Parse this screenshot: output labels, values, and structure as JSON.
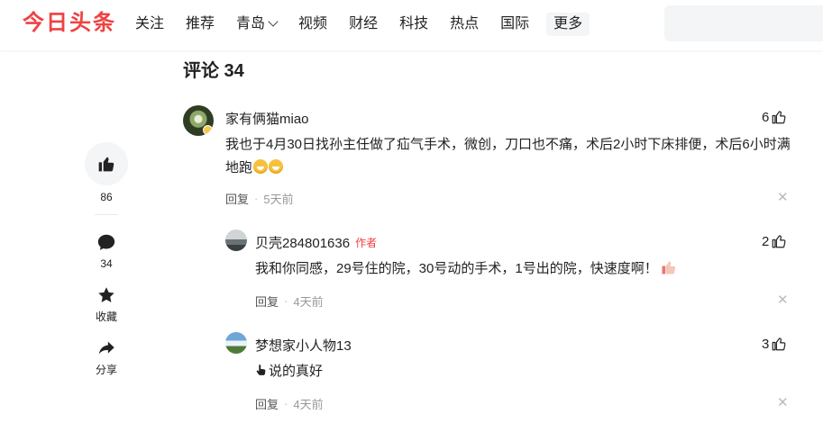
{
  "header": {
    "logo": "今日头条",
    "nav": [
      "关注",
      "推荐",
      "青岛",
      "视频",
      "财经",
      "科技",
      "热点",
      "国际"
    ],
    "more": "更多"
  },
  "side": {
    "like_count": "86",
    "comment_count": "34",
    "collect_label": "收藏",
    "share_label": "分享"
  },
  "comments_title": "评论 34",
  "comments": [
    {
      "name": "家有俩猫miao",
      "likes": "6",
      "content": "我也于4月30日找孙主任做了疝气手术，微创，刀口也不痛，术后2小时下床排便，术后6小时满地跑",
      "reply": "回复",
      "time": "5天前"
    },
    {
      "name": "贝壳284801636",
      "author_tag": "作者",
      "likes": "2",
      "content": "我和你同感，29号住的院，30号动的手术，1号出的院，快速度啊！",
      "reply": "回复",
      "time": "4天前"
    },
    {
      "name": "梦想家小人物13",
      "likes": "3",
      "content": "说的真好",
      "reply": "回复",
      "time": "4天前"
    }
  ],
  "icons": {
    "like": "thumbs-up-icon",
    "comment": "chat-bubble-icon",
    "collect": "star-icon",
    "share": "share-arrow-icon",
    "close": "close-icon"
  },
  "colors": {
    "brand": "#f04142",
    "meta": "#999999"
  }
}
